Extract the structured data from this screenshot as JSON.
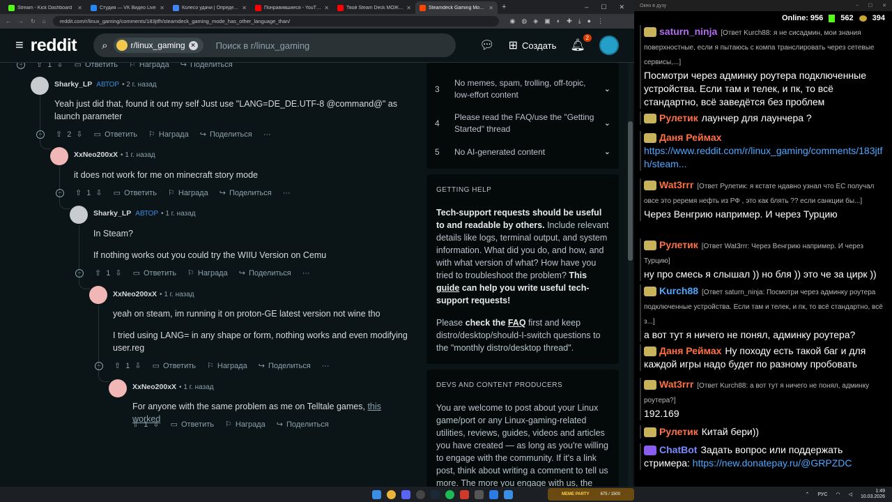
{
  "browser": {
    "tabs": [
      {
        "title": "Stream - Kick Dashboard",
        "color": "#53fc18"
      },
      {
        "title": "Студия — VK Видео Live",
        "color": "#2787f5"
      },
      {
        "title": "Колесо удачи | Определите п",
        "color": "#4285f4"
      },
      {
        "title": "Понравившиеся - YouTube",
        "color": "#ff0000"
      },
      {
        "title": "Твой Steam Deck МОЖЕТ БОЛ",
        "color": "#ff0000"
      },
      {
        "title": "Steamdeck Gaming Mode has",
        "color": "#ff4500"
      }
    ],
    "new_tab": "+",
    "window_controls": [
      "–",
      "☐",
      "✕"
    ],
    "url": "reddit.com/r/linux_gaming/comments/183jtfh/steamdeck_gaming_mode_has_other_language_than/"
  },
  "reddit_header": {
    "logo": "reddit",
    "community_chip": "r/linux_gaming",
    "search_placeholder": "Поиск в r/linux_gaming",
    "create_label": "Создать",
    "notifications_count": "2"
  },
  "comments": [
    {
      "author": "",
      "op": "",
      "time": "",
      "body": [],
      "upvotes": "1",
      "reply": "Ответить",
      "award": "Награда",
      "share": "Поделиться"
    },
    {
      "author": "Sharky_LP",
      "op": "АВТОР",
      "time": "• 2 г. назад",
      "body": [
        "Yeah just did that, found it out my self Just use \"LANG=DE_DE.UTF-8 @command@\" as launch parameter"
      ],
      "upvotes": "2",
      "reply": "Ответить",
      "award": "Награда",
      "share": "Поделиться",
      "more": "···"
    },
    {
      "author": "XxNeo200xX",
      "op": "",
      "time": "• 1 г. назад",
      "body": [
        "it does not work for me on minecraft story mode"
      ],
      "upvotes": "1",
      "reply": "Ответить",
      "award": "Награда",
      "share": "Поделиться",
      "more": "···"
    },
    {
      "author": "Sharky_LP",
      "op": "АВТОР",
      "time": "• 1 г. назад",
      "body": [
        "In Steam?",
        "If nothing works out you could try the WIIU Version on Cemu"
      ],
      "upvotes": "1",
      "reply": "Ответить",
      "award": "Награда",
      "share": "Поделиться",
      "more": "···"
    },
    {
      "author": "XxNeo200xX",
      "op": "",
      "time": "• 1 г. назад",
      "body": [
        "yeah on steam, im running it on proton-GE latest version not wine tho",
        "I tried using LANG= in any shape or form, nothing works and even modifying user.reg"
      ],
      "upvotes": "1",
      "reply": "Ответить",
      "award": "Награда",
      "share": "Поделиться",
      "more": "···"
    },
    {
      "author": "XxNeo200xX",
      "op": "",
      "time": "• 1 г. назад",
      "body": [
        "For anyone with the same problem as me on Telltale games, "
      ],
      "link": "this worked",
      "upvotes": "1",
      "reply": "Ответить",
      "award": "Награда",
      "share": "Поделиться"
    }
  ],
  "sidebar": {
    "rules": [
      {
        "num": "3",
        "text": "No memes, spam, trolling, off-topic, low-effort content"
      },
      {
        "num": "4",
        "text": "Please read the FAQ/use the \"Getting Started\" thread"
      },
      {
        "num": "5",
        "text": "No AI-generated content"
      }
    ],
    "getting_help": {
      "heading": "GETTING HELP",
      "p1_bold": "Tech-support requests should be useful to and readable by others.",
      "p1_rest": " Include relevant details like logs, terminal output, and system information. What did you do, and how, and with what version of what? How have you tried to troubleshoot the problem? ",
      "p1_bold2": "This ",
      "p1_link": "guide",
      "p1_bold3": " can help you write useful tech-support requests!",
      "p2_a": "Please ",
      "p2_bold": "check the ",
      "p2_link": "FAQ",
      "p2_rest": " first and keep distro/desktop/should-I-switch questions to the \"monthly distro/desktop thread\"."
    },
    "devs": {
      "heading": "DEVS AND CONTENT PRODUCERS",
      "text": "You are welcome to post about your Linux game/port or any Linux-gaming-related utilities, reviews, guides, videos and articles you have created — as long as you're willing to engage with the community. If it's a link post, think about writing a comment to tell us more. The more you engage with us, the more we like it!"
    }
  },
  "chat": {
    "window_title": "Окно в дузу",
    "online_label": "Online:",
    "online_count": "956",
    "kick_count": "562",
    "gold_count": "394",
    "messages": [
      {
        "nick": "saturn_ninja",
        "color": "#b46cf0",
        "reply": "[Ответ Kurch88: я не сисадмин, мои знания поверхностные, если я пытаюсь с компа транслировать через сетевые сервисы,...]",
        "text": "Посмотри через админку роутера подключенные устройства. Если там и телек, и пк, то всё стандартно, всё заведётся без проблем"
      },
      {
        "nick": "Рулетик",
        "color": "#ff7043",
        "reply": "",
        "text": "лаунчер для лаунчера ?"
      },
      {
        "nick": "Даня Реймах",
        "color": "#ff7043",
        "reply": "",
        "text": "",
        "link": "https://www.reddit.com/r/linux_gaming/comments/183jtfh/steam..."
      },
      {
        "nick": "Wat3rrr",
        "color": "#ff7043",
        "reply": "[Ответ Рулетик: я кстате ндавно узнал что ЕС получал овсе это реремя нефть из РФ , это как блять ?? если санкции бы...]",
        "text": "Через Венгрию например. И через Турцию"
      },
      {
        "nick": "Рулетик",
        "color": "#ff7043",
        "reply": "[Ответ Wat3rrr: Через Венгрию например. И через Турцию]",
        "text": "ну про смесь я слышал )) но бля )) это че за цирк ))"
      },
      {
        "nick": "Kurch88",
        "color": "#4ea8ff",
        "reply": "[Ответ saturn_ninja: Посмотри через админку роутера подключенные устройства. Если там и телек, и пк, то всё стандартно, всё з...]",
        "text": "а вот тут я ничего не понял, админку роутера?"
      },
      {
        "nick": "Даня Реймах",
        "color": "#ff7043",
        "reply": "",
        "text": "Ну походу есть такой баг и для каждой игры надо будет по разному пробовать"
      },
      {
        "nick": "Wat3rrr",
        "color": "#ff7043",
        "reply": "[Ответ Kurch88: а вот тут я ничего не понял, админку роутера?]",
        "text": "192.169"
      },
      {
        "nick": "Рулетик",
        "color": "#ff7043",
        "reply": "",
        "text": "Китай бери))"
      },
      {
        "nick": "ChatBot",
        "color": "#7b8cff",
        "reply": "",
        "text": "Задать вопрос или поддержать стримера: ",
        "link": "https://new.donatepay.ru/@GRPZDC"
      }
    ]
  },
  "taskbar": {
    "meme_label": "MEME PARTY",
    "meme_progress": "675 / 1500",
    "lang": "РУС",
    "time": "1:49",
    "date": "10.03.2026"
  }
}
